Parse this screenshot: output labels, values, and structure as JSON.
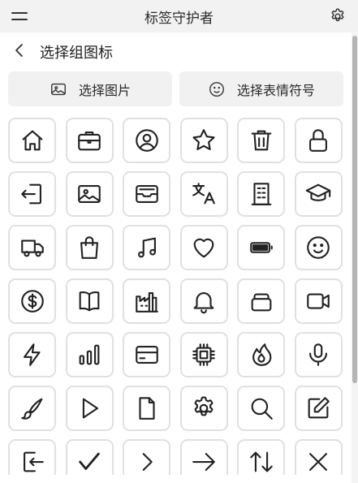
{
  "app": {
    "title": "标签守护者"
  },
  "header": {
    "title": "选择组图标"
  },
  "actions": {
    "pick_image": "选择图片",
    "pick_emoji": "选择表情符号"
  },
  "icons": [
    [
      "home",
      "briefcase",
      "user-circle",
      "star",
      "trash",
      "lock"
    ],
    [
      "login",
      "image",
      "inbox",
      "translate",
      "building",
      "graduation-cap"
    ],
    [
      "truck",
      "shopping-bag",
      "music-note",
      "heart",
      "battery",
      "smile"
    ],
    [
      "dollar-circle",
      "book",
      "factory",
      "bell",
      "layers",
      "video-camera"
    ],
    [
      "lightning",
      "bar-chart",
      "credit-card",
      "cpu-chip",
      "fire",
      "microphone"
    ],
    [
      "brush",
      "play",
      "document",
      "gear",
      "search",
      "edit"
    ],
    [
      "logout",
      "check",
      "chevron-right",
      "arrow-right",
      "arrows-up-down",
      "close"
    ]
  ]
}
